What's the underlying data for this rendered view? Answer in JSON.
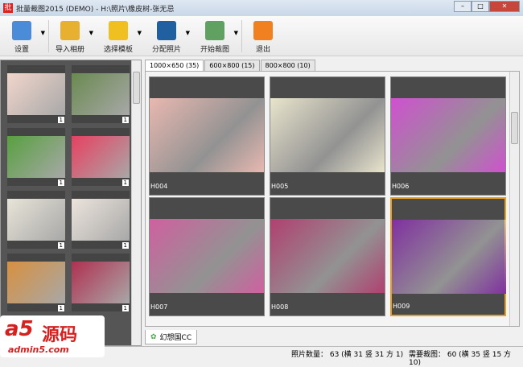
{
  "window": {
    "title": "批量裁图2015 (DEMO) - H:\\照片\\橡皮树-张无忌",
    "min": "–",
    "max": "□",
    "close": "✕"
  },
  "toolbar": [
    {
      "label": "设置",
      "icon": "settings-icon",
      "color": "#4a8cd8"
    },
    {
      "label": "导入相册",
      "icon": "folder-icon",
      "color": "#e8b030"
    },
    {
      "label": "选择模板",
      "icon": "puzzle-icon",
      "color": "#f0c020"
    },
    {
      "label": "分配照片",
      "icon": "portrait-icon",
      "color": "#2060a0"
    },
    {
      "label": "开始裁图",
      "icon": "crop-image-icon",
      "color": "#60a060"
    },
    {
      "label": "退出",
      "icon": "exit-icon",
      "color": "#f08020"
    }
  ],
  "tabs": [
    {
      "label": "1000×650 (35)"
    },
    {
      "label": "600×800 (15)"
    },
    {
      "label": "800×800 (10)"
    }
  ],
  "left_thumbs": [
    {
      "num": "1",
      "color": "#f2d6cc"
    },
    {
      "num": "1",
      "color": "#6a8a50"
    },
    {
      "num": "1",
      "color": "#58a040"
    },
    {
      "num": "1",
      "color": "#e84060"
    },
    {
      "num": "1",
      "color": "#e8e4d8"
    },
    {
      "num": "1",
      "color": "#ece4dc"
    },
    {
      "num": "1",
      "color": "#d89040"
    },
    {
      "num": "1",
      "color": "#b03050"
    }
  ],
  "cells": [
    {
      "label": "H004",
      "color": "#e9b8b0"
    },
    {
      "label": "H005",
      "color": "#e8e4cc"
    },
    {
      "label": "H006",
      "color": "#d050d0"
    },
    {
      "label": "H007",
      "color": "#d060a0"
    },
    {
      "label": "H008",
      "color": "#b04070"
    },
    {
      "label": "H009",
      "color": "#8030a0"
    }
  ],
  "bottom_tab": "幻想国CC",
  "status": {
    "photos": "照片数量： 63 (横 31 竖 31 方 1)",
    "needed": "需要裁图： 60 (横 35 竖 15 方 10)"
  },
  "watermark": {
    "brand": "a5",
    "cn": "源码",
    "url": "admin5.com"
  }
}
